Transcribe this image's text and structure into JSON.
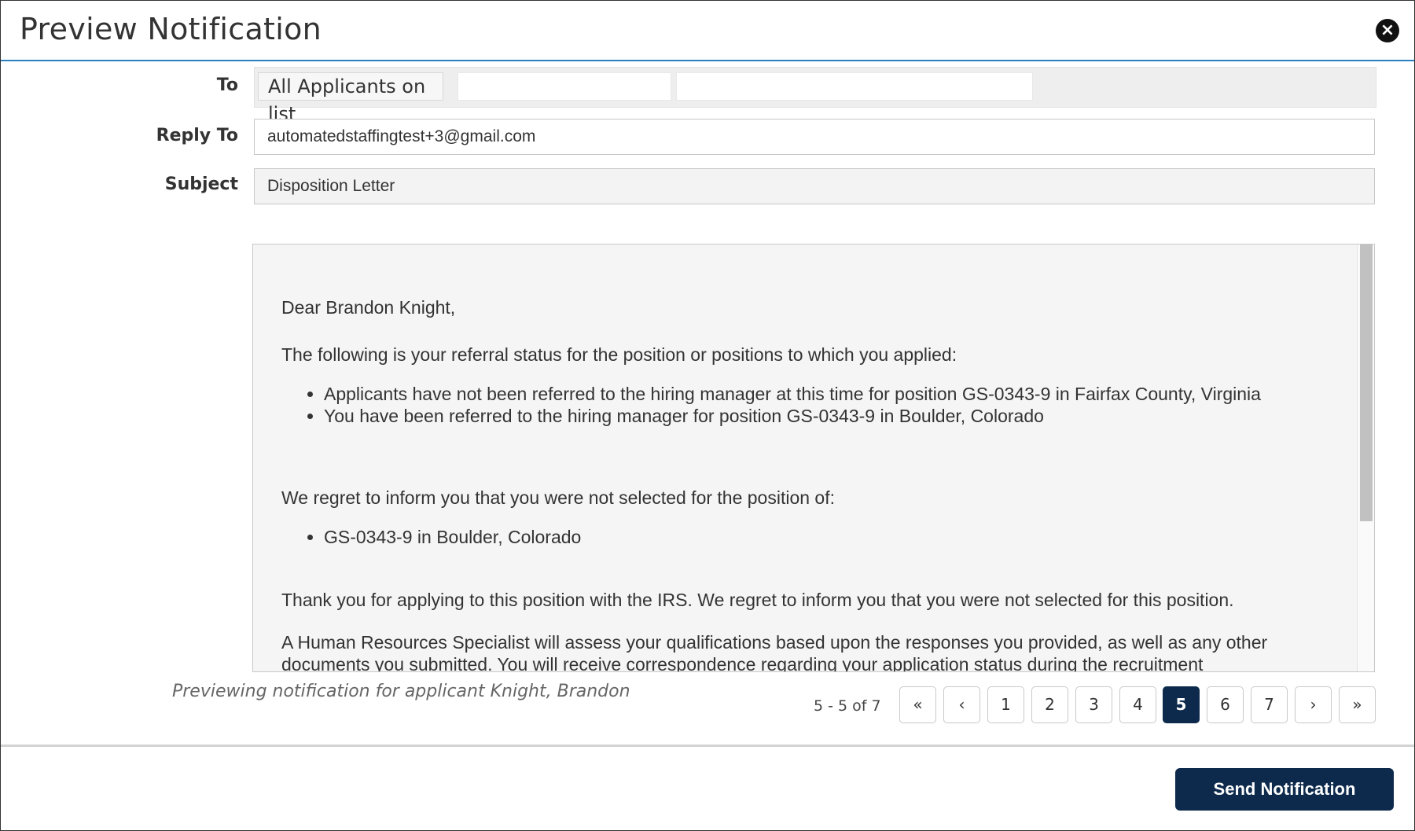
{
  "header": {
    "title": "Preview Notification",
    "close_symbol": "×"
  },
  "form": {
    "to_label": "To",
    "to_chip": "All Applicants on list",
    "reply_to_label": "Reply To",
    "reply_to_value": "automatedstaffingtest+3@gmail.com",
    "subject_label": "Subject",
    "subject_value": "Disposition Letter"
  },
  "letter": {
    "greeting": "Dear Brandon Knight,",
    "intro": "The following is your referral status for the position or positions to which you applied:",
    "referral_items": [
      "Applicants have not been referred to the hiring manager at this time for position GS-0343-9 in Fairfax County, Virginia",
      "You have been referred to the hiring manager for position GS-0343-9 in Boulder, Colorado"
    ],
    "regret": "We regret to inform you that you were not selected for the position of:",
    "not_selected_items": [
      "GS-0343-9 in Boulder, Colorado"
    ],
    "thanks": "Thank you for applying to this position with the IRS. We regret to inform you that you were not selected for this position.",
    "assessment": "A Human Resources Specialist will assess your qualifications based upon the responses you provided, as well as any other documents you submitted. You will receive correspondence regarding your application status during the recruitment"
  },
  "preview_note": "Previewing notification for applicant Knight, Brandon",
  "pagination": {
    "range": "5 - 5 of 7",
    "first": "«",
    "prev": "‹",
    "next": "›",
    "last": "»",
    "pages": [
      "1",
      "2",
      "3",
      "4",
      "5",
      "6",
      "7"
    ],
    "current": "5"
  },
  "footer": {
    "send_label": "Send Notification"
  },
  "colors": {
    "accent": "#2a7fc1",
    "primary_button": "#0d2a4c"
  }
}
